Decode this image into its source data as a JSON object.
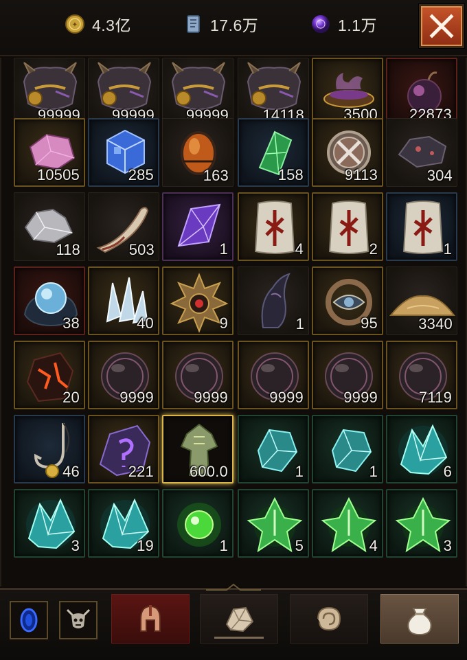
{
  "currencies": [
    {
      "id": "gold",
      "icon": "gold-coin-icon",
      "value": "4.3亿"
    },
    {
      "id": "scroll",
      "icon": "blue-scroll-icon",
      "value": "17.6万"
    },
    {
      "id": "orb",
      "icon": "purple-orb-icon",
      "value": "1.1万"
    }
  ],
  "close_icon": "close-icon",
  "inventory": {
    "rows": [
      [
        {
          "icon": "horned-helmet-icon",
          "qty": "99999",
          "rarity": "dark"
        },
        {
          "icon": "horned-helmet-icon",
          "qty": "99999",
          "rarity": "dark"
        },
        {
          "icon": "horned-helmet-icon",
          "qty": "99999",
          "rarity": "dark"
        },
        {
          "icon": "horned-helmet-icon",
          "qty": "14118",
          "rarity": "dark"
        },
        {
          "icon": "smoking-cauldron-icon",
          "qty": "3500",
          "rarity": "gold"
        },
        {
          "icon": "dark-purple-orb-icon",
          "qty": "22873",
          "rarity": "red"
        }
      ],
      [
        {
          "icon": "pink-ore-icon",
          "qty": "10505",
          "rarity": "gold"
        },
        {
          "icon": "blue-crystal-cube-icon",
          "qty": "285",
          "rarity": "blue"
        },
        {
          "icon": "orange-egg-gem-icon",
          "qty": "163",
          "rarity": "dark"
        },
        {
          "icon": "green-crystal-icon",
          "qty": "158",
          "rarity": "blue"
        },
        {
          "icon": "crossed-swords-shield-icon",
          "qty": "9113",
          "rarity": "gold"
        },
        {
          "icon": "dark-ore-icon",
          "qty": "304",
          "rarity": "dark"
        }
      ],
      [
        {
          "icon": "silver-ore-icon",
          "qty": "118",
          "rarity": "dark"
        },
        {
          "icon": "bone-fang-icon",
          "qty": "503",
          "rarity": "dark"
        },
        {
          "icon": "purple-crystal-icon",
          "qty": "1",
          "rarity": "purple"
        },
        {
          "icon": "rune-stone-icon",
          "qty": "4",
          "rarity": "gold"
        },
        {
          "icon": "rune-stone-icon",
          "qty": "2",
          "rarity": "gold"
        },
        {
          "icon": "rune-stone-icon",
          "qty": "1",
          "rarity": "blue"
        }
      ],
      [
        {
          "icon": "glowing-orb-rock-icon",
          "qty": "38",
          "rarity": "red"
        },
        {
          "icon": "ice-shards-icon",
          "qty": "40",
          "rarity": "gold"
        },
        {
          "icon": "spiked-amulet-icon",
          "qty": "9",
          "rarity": "gold"
        },
        {
          "icon": "dark-horn-icon",
          "qty": "1",
          "rarity": "dark"
        },
        {
          "icon": "eye-amulet-icon",
          "qty": "95",
          "rarity": "gold"
        },
        {
          "icon": "sand-pile-icon",
          "qty": "3340",
          "rarity": "dark"
        }
      ],
      [
        {
          "icon": "lava-stone-icon",
          "qty": "20",
          "rarity": "gold"
        },
        {
          "icon": "dark-pearl-icon",
          "qty": "9999",
          "rarity": "gold"
        },
        {
          "icon": "dark-pearl-icon",
          "qty": "9999",
          "rarity": "gold"
        },
        {
          "icon": "dark-pearl-icon",
          "qty": "9999",
          "rarity": "gold"
        },
        {
          "icon": "dark-pearl-icon",
          "qty": "9999",
          "rarity": "gold"
        },
        {
          "icon": "dark-pearl-icon",
          "qty": "7119",
          "rarity": "gold"
        }
      ],
      [
        {
          "icon": "fishing-hook-icon",
          "qty": "46",
          "rarity": "blue"
        },
        {
          "icon": "purple-rune-stone-icon",
          "qty": "221",
          "rarity": "gold"
        },
        {
          "icon": "mossy-idol-icon",
          "qty": "600.0",
          "rarity": "selected"
        },
        {
          "icon": "teal-crystal-icon",
          "qty": "1",
          "rarity": "green"
        },
        {
          "icon": "teal-crystal-icon",
          "qty": "1",
          "rarity": "green"
        },
        {
          "icon": "teal-spiky-crystal-icon",
          "qty": "6",
          "rarity": "green"
        }
      ],
      [
        {
          "icon": "teal-spiky-crystal-icon",
          "qty": "3",
          "rarity": "green"
        },
        {
          "icon": "teal-spiky-crystal-icon",
          "qty": "19",
          "rarity": "green"
        },
        {
          "icon": "green-glow-orb-icon",
          "qty": "1",
          "rarity": "green"
        },
        {
          "icon": "green-leaf-crystal-icon",
          "qty": "5",
          "rarity": "green"
        },
        {
          "icon": "green-leaf-crystal-icon",
          "qty": "4",
          "rarity": "green"
        },
        {
          "icon": "green-leaf-crystal-icon",
          "qty": "3",
          "rarity": "green"
        }
      ]
    ]
  },
  "bottom_bar": {
    "left_buttons": [
      {
        "id": "btn-left1",
        "icon": "blue-portal-icon"
      },
      {
        "id": "btn-left2",
        "icon": "demon-skull-icon"
      }
    ],
    "tabs": [
      {
        "id": "tab-armor",
        "icon": "spartan-helmet-icon",
        "active": false
      },
      {
        "id": "tab-gem",
        "icon": "rough-gem-icon",
        "active": false
      },
      {
        "id": "tab-material",
        "icon": "swirl-stone-icon",
        "active": false
      },
      {
        "id": "tab-bag",
        "icon": "loot-bag-icon",
        "active": true
      }
    ]
  },
  "colors": {
    "accent_gold": "#d8b64a",
    "close_button": "#b04722",
    "text": "#f1eee8"
  }
}
